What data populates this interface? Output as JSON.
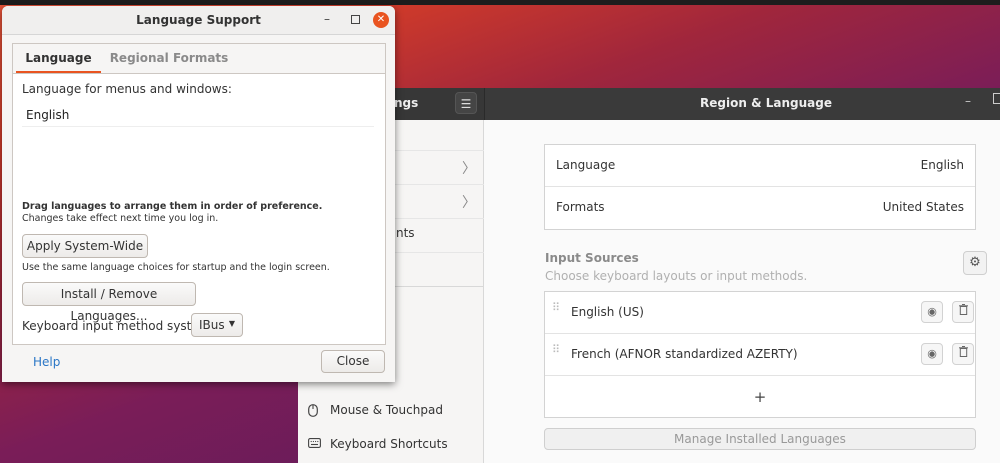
{
  "settings_window": {
    "sidebar_title": "ngs",
    "main_title": "Region & Language",
    "sidebar": {
      "partial_items": [
        "nts"
      ],
      "items": [
        {
          "label": "Mouse & Touchpad",
          "icon": "mouse-icon"
        },
        {
          "label": "Keyboard Shortcuts",
          "icon": "keyboard-icon"
        }
      ]
    },
    "region": {
      "language_label": "Language",
      "language_value": "English",
      "formats_label": "Formats",
      "formats_value": "United States"
    },
    "input_sources": {
      "title": "Input Sources",
      "subtitle": "Choose keyboard layouts or input methods.",
      "items": [
        "English (US)",
        "French (AFNOR standardized AZERTY)"
      ],
      "add_label": "+"
    },
    "manage_button": "Manage Installed Languages"
  },
  "dialog": {
    "title": "Language Support",
    "tabs": [
      {
        "label": "Language",
        "active": true
      },
      {
        "label": "Regional Formats",
        "active": false
      }
    ],
    "menus_label": "Language for menus and windows:",
    "languages": [
      "English"
    ],
    "drag_note": "Drag languages to arrange them in order of preference.",
    "changes_note": "Changes take effect next time you log in.",
    "apply_button": "Apply System-Wide",
    "apply_note": "Use the same language choices for startup and the login screen.",
    "install_button": "Install / Remove Languages...",
    "input_method_label": "Keyboard input method system:",
    "input_method_value": "IBus",
    "help_label": "Help",
    "close_label": "Close"
  },
  "colors": {
    "accent": "#e95420",
    "link": "#2a76c6"
  }
}
